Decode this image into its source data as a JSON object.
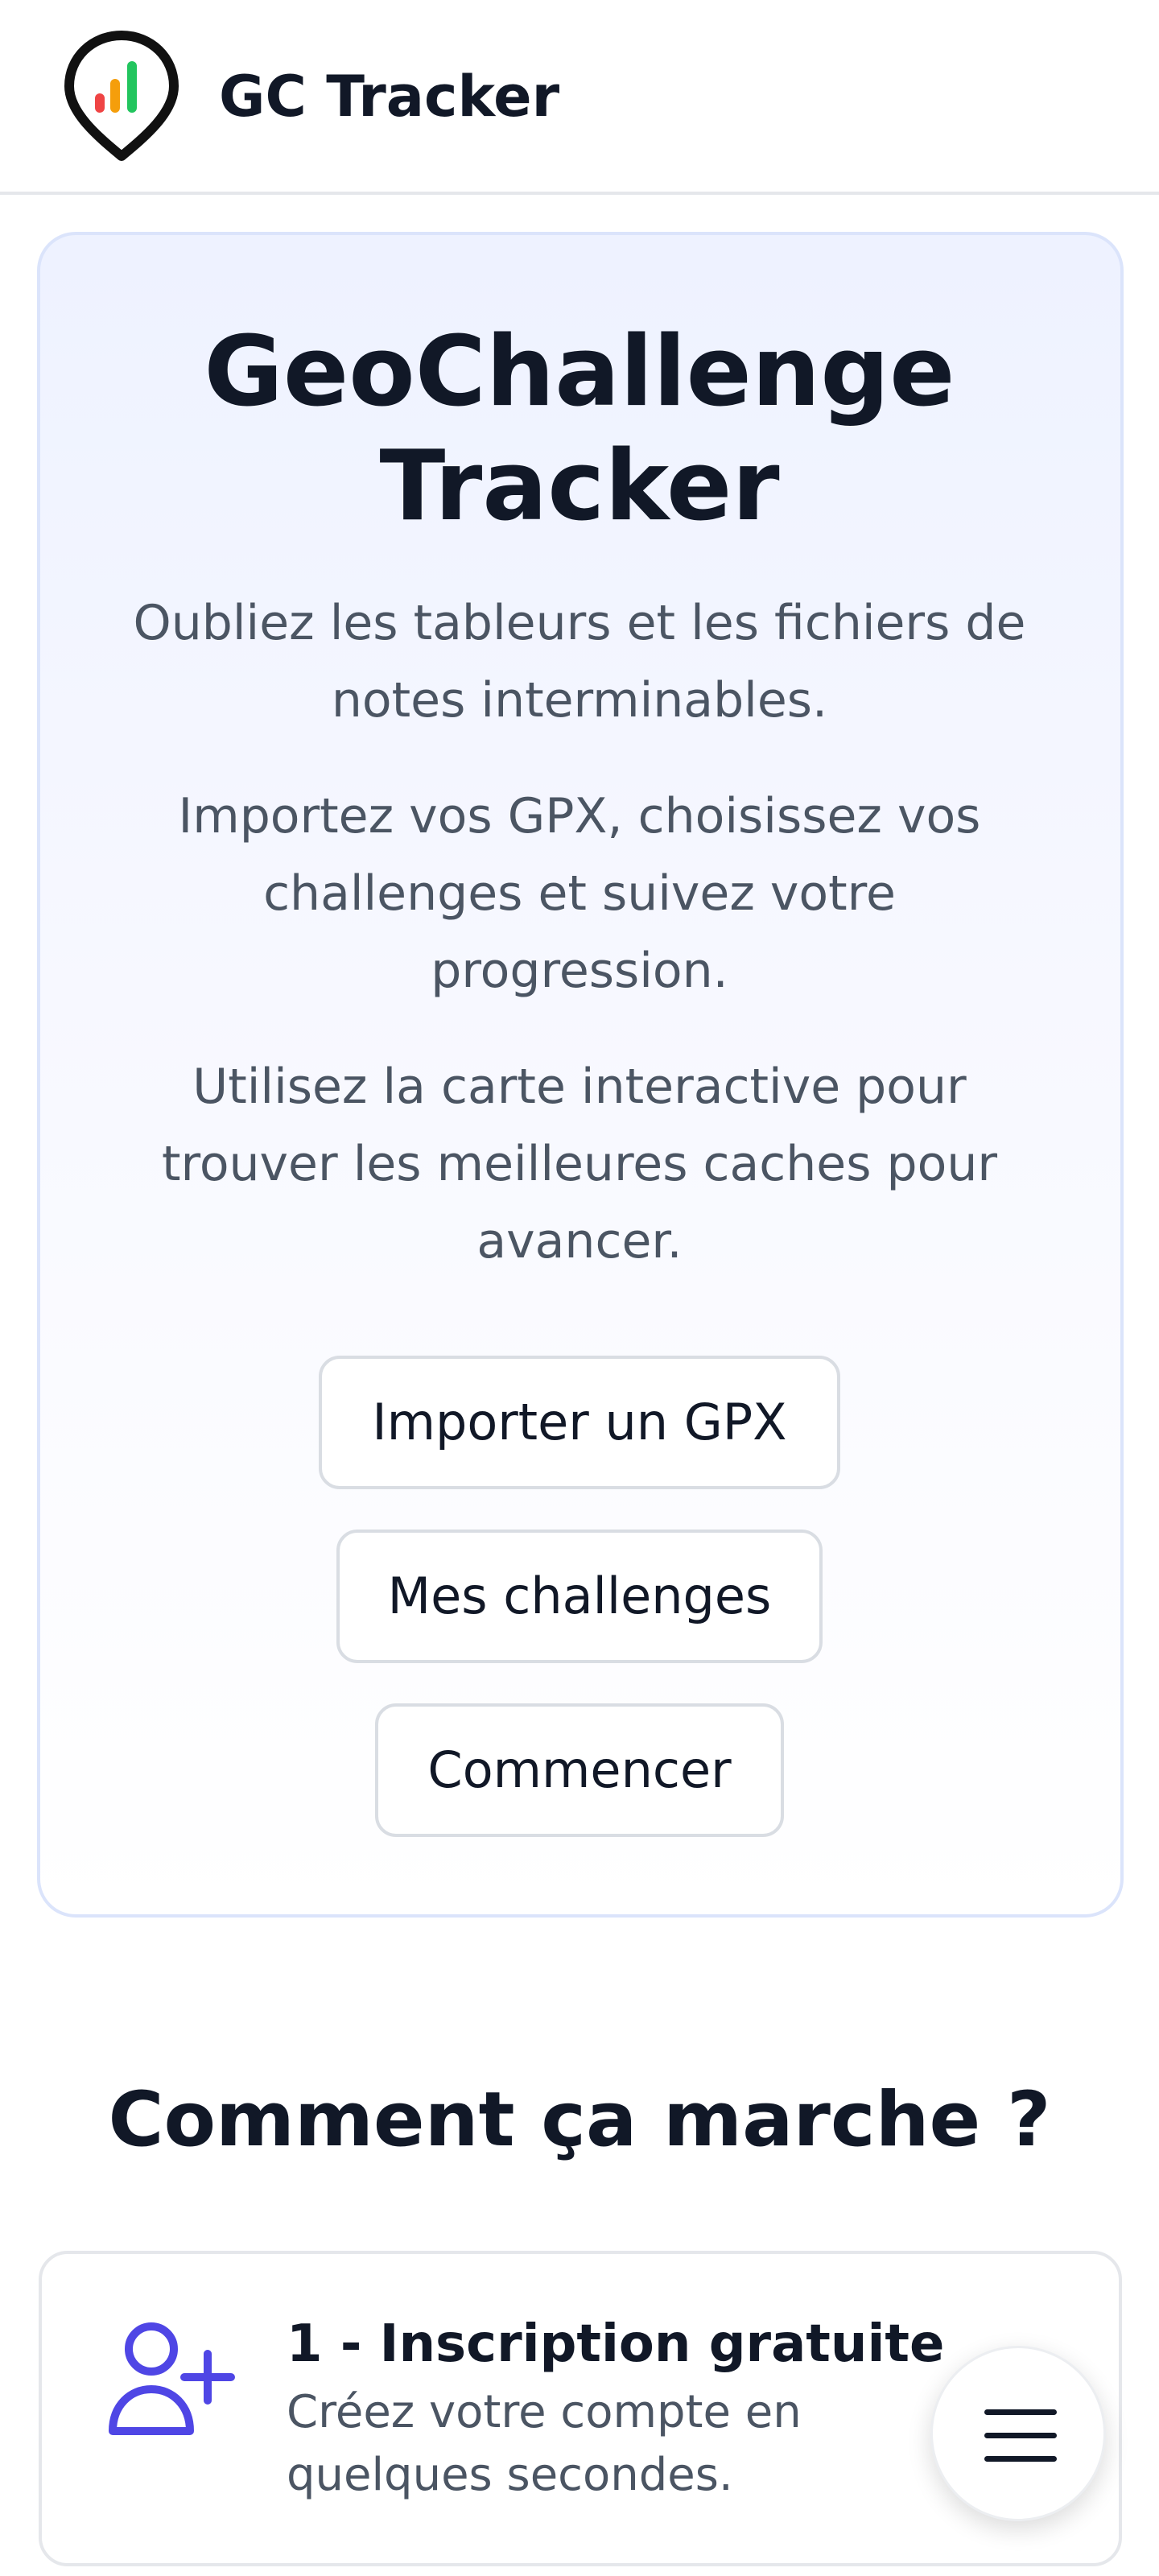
{
  "header": {
    "brand_name": "GC Tracker",
    "logo_icon": "map-pin-chart-icon"
  },
  "hero": {
    "title_line1": "GeoChallenge",
    "title_line2": "Tracker",
    "paragraph1": "Oubliez les tableurs et les fichiers de notes interminables.",
    "paragraph2": "Importez vos GPX, choisissez vos challenges et suivez votre progression.",
    "paragraph3": "Utilisez la carte interactive pour trouver les meilleures caches pour avancer.",
    "buttons": {
      "import_gpx": "Importer un GPX",
      "my_challenges": "Mes challenges",
      "start": "Commencer"
    }
  },
  "how_it_works": {
    "title": "Comment ça marche ?",
    "steps": [
      {
        "icon": "user-plus-icon",
        "title": "1 - Inscription gratuite",
        "description": "Créez votre compte en quelques secondes."
      }
    ]
  },
  "fab": {
    "icon": "hamburger-menu-icon"
  },
  "colors": {
    "accent": "#4f46e5",
    "logo_bar_red": "#ef4444",
    "logo_bar_orange": "#f59e0b",
    "logo_bar_green": "#22c55e"
  }
}
